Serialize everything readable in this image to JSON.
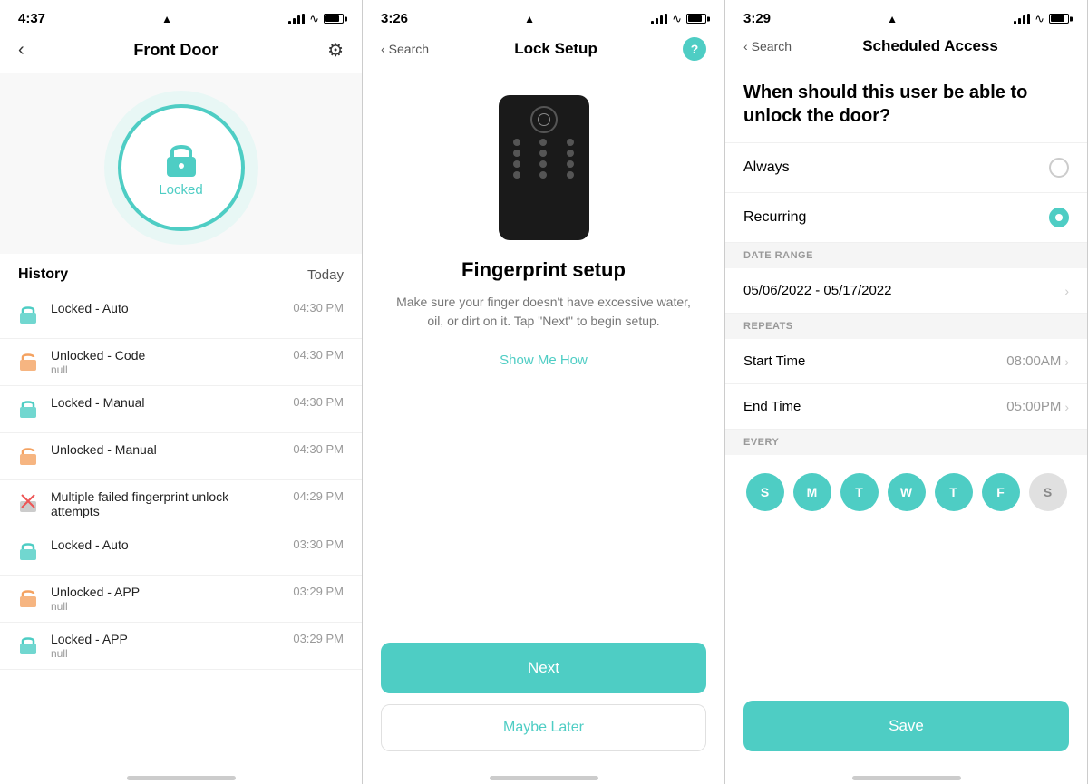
{
  "screen1": {
    "status": {
      "time": "4:37",
      "location": "▲"
    },
    "nav": {
      "title": "Front Door",
      "back": "‹",
      "gear": "⚙"
    },
    "lock": {
      "status": "Locked"
    },
    "history": {
      "label": "History",
      "today": "Today",
      "items": [
        {
          "type": "locked",
          "title": "Locked - Auto",
          "sub": "",
          "time": "04:30 PM",
          "color": "#4ecdc4"
        },
        {
          "type": "unlocked",
          "title": "Unlocked - Code",
          "sub": "null",
          "time": "04:30 PM",
          "color": "#f4a261"
        },
        {
          "type": "locked",
          "title": "Locked - Manual",
          "sub": "",
          "time": "04:30 PM",
          "color": "#4ecdc4"
        },
        {
          "type": "unlocked",
          "title": "Unlocked - Manual",
          "sub": "",
          "time": "04:30 PM",
          "color": "#f4a261"
        },
        {
          "type": "failed",
          "title": "Multiple failed fingerprint unlock attempts",
          "sub": "",
          "time": "04:29 PM",
          "color": "#aaa"
        },
        {
          "type": "locked",
          "title": "Locked - Auto",
          "sub": "",
          "time": "03:30 PM",
          "color": "#4ecdc4"
        },
        {
          "type": "unlocked",
          "title": "Unlocked - APP",
          "sub": "null",
          "time": "03:29 PM",
          "color": "#f4a261"
        },
        {
          "type": "locked",
          "title": "Locked - APP",
          "sub": "null",
          "time": "03:29 PM",
          "color": "#4ecdc4"
        }
      ]
    }
  },
  "screen2": {
    "status": {
      "time": "3:26",
      "location": "▲"
    },
    "nav": {
      "back_text": "Search",
      "title": "Lock Setup",
      "help": "?"
    },
    "setup": {
      "title": "Fingerprint setup",
      "description": "Make sure your finger doesn't have excessive water, oil, or dirt on it. Tap \"Next\" to begin setup.",
      "show_me_how": "Show Me How",
      "btn_next": "Next",
      "btn_maybe": "Maybe Later"
    }
  },
  "screen3": {
    "status": {
      "time": "3:29",
      "location": "▲"
    },
    "nav": {
      "back": "‹",
      "back_text": "Search",
      "title": "Scheduled Access"
    },
    "question": "When should this user be able to unlock the door?",
    "options": [
      {
        "label": "Always",
        "selected": false
      },
      {
        "label": "Recurring",
        "selected": true
      }
    ],
    "date_range": {
      "section": "DATE RANGE",
      "value": "05/06/2022 - 05/17/2022"
    },
    "repeats": {
      "section": "REPEATS",
      "start_time": {
        "label": "Start Time",
        "value": "08:00AM"
      },
      "end_time": {
        "label": "End Time",
        "value": "05:00PM"
      }
    },
    "every": {
      "section": "EVERY",
      "days": [
        {
          "letter": "S",
          "active": true
        },
        {
          "letter": "M",
          "active": true
        },
        {
          "letter": "T",
          "active": true
        },
        {
          "letter": "W",
          "active": true
        },
        {
          "letter": "T",
          "active": true
        },
        {
          "letter": "F",
          "active": true
        },
        {
          "letter": "S",
          "active": false
        }
      ]
    },
    "save_btn": "Save"
  }
}
